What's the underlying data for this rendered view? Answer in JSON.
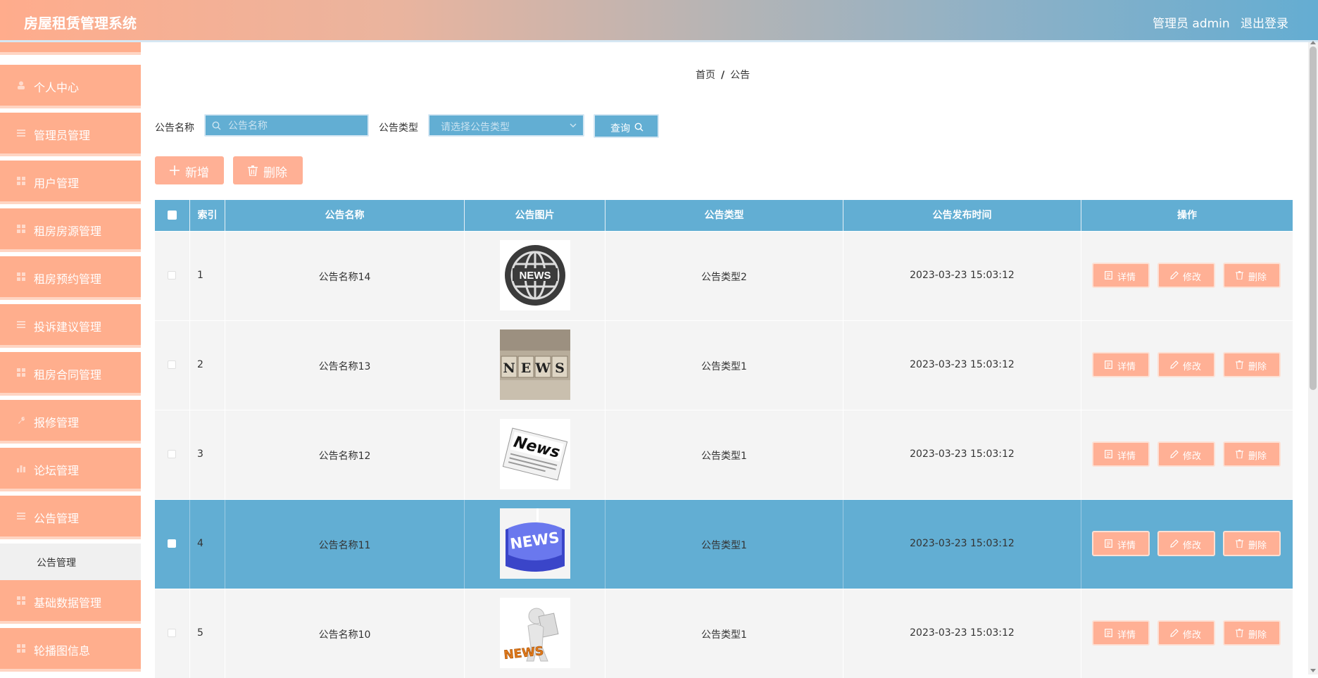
{
  "header": {
    "title": "房屋租赁管理系统",
    "user_label": "管理员 admin",
    "logout_label": "退出登录"
  },
  "sidebar": {
    "items": [
      {
        "label": "个人中心",
        "icon": "user-icon"
      },
      {
        "label": "管理员管理",
        "icon": "list-icon"
      },
      {
        "label": "用户管理",
        "icon": "grid-icon"
      },
      {
        "label": "租房房源管理",
        "icon": "grid-icon"
      },
      {
        "label": "租房预约管理",
        "icon": "grid-icon"
      },
      {
        "label": "投诉建议管理",
        "icon": "list-icon"
      },
      {
        "label": "租房合同管理",
        "icon": "grid-icon"
      },
      {
        "label": "报修管理",
        "icon": "wrench-icon"
      },
      {
        "label": "论坛管理",
        "icon": "chart-icon"
      },
      {
        "label": "公告管理",
        "icon": "list-icon"
      },
      {
        "label": "基础数据管理",
        "icon": "grid-icon"
      },
      {
        "label": "轮播图信息",
        "icon": "grid-icon"
      }
    ],
    "submenu": {
      "label": "公告管理"
    }
  },
  "breadcrumb": {
    "home": "首页",
    "separator": "/",
    "current": "公告"
  },
  "filters": {
    "name_label": "公告名称",
    "name_placeholder": "公告名称",
    "type_label": "公告类型",
    "type_placeholder": "请选择公告类型",
    "query_label": "查询"
  },
  "actions": {
    "add_label": "新增",
    "delete_label": "删除"
  },
  "table": {
    "columns": [
      "索引",
      "公告名称",
      "公告图片",
      "公告类型",
      "公告发布时间",
      "操作"
    ],
    "rows": [
      {
        "index": "1",
        "name": "公告名称14",
        "type": "公告类型2",
        "time": "2023-03-23 15:03:12",
        "image": "globe-news-icon"
      },
      {
        "index": "2",
        "name": "公告名称13",
        "type": "公告类型1",
        "time": "2023-03-23 15:03:12",
        "image": "news-blocks-photo"
      },
      {
        "index": "3",
        "name": "公告名称12",
        "type": "公告类型1",
        "time": "2023-03-23 15:03:12",
        "image": "newspaper-icon"
      },
      {
        "index": "4",
        "name": "公告名称11",
        "type": "公告类型1",
        "time": "2023-03-23 15:03:12",
        "image": "news-key-icon"
      },
      {
        "index": "5",
        "name": "公告名称10",
        "type": "公告类型1",
        "time": "2023-03-23 15:03:12",
        "image": "news-person-icon"
      }
    ],
    "op_labels": {
      "detail": "详情",
      "edit": "修改",
      "delete": "删除"
    }
  },
  "colors": {
    "accent_orange": "#ffae8d",
    "accent_blue": "#62aed3",
    "header_gradient_start": "#ffac8c",
    "header_gradient_end": "#64add2"
  }
}
